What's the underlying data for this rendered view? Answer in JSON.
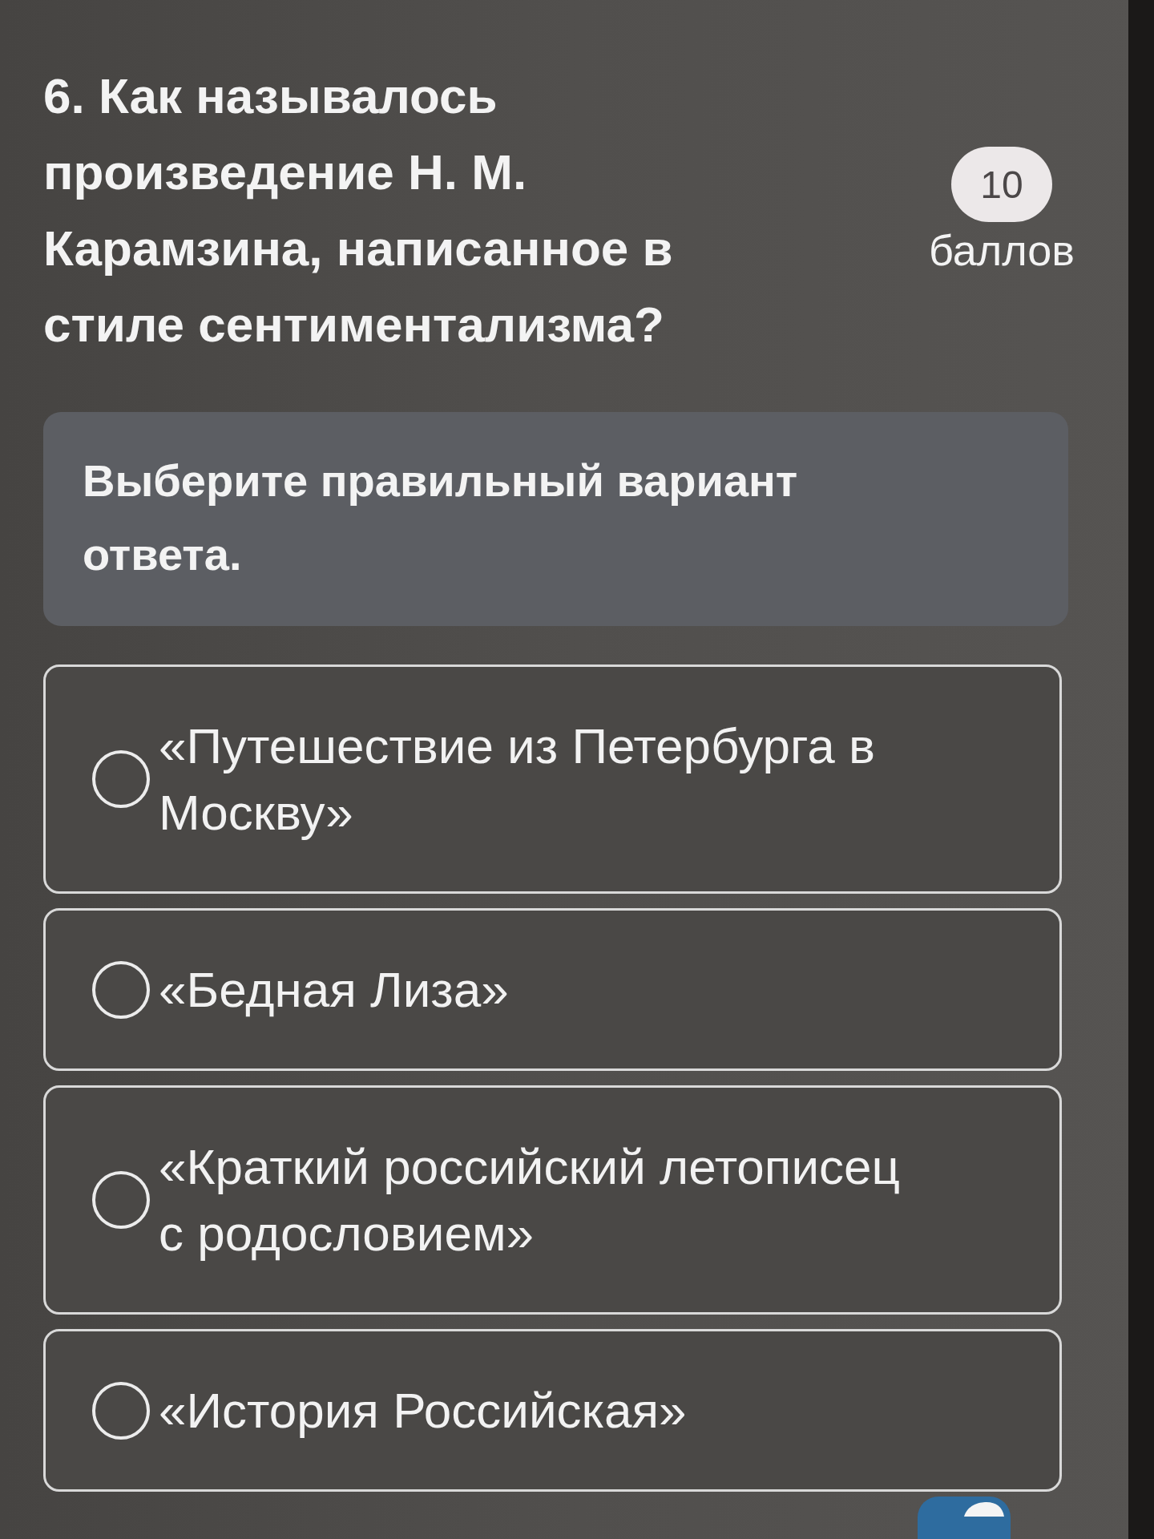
{
  "question": {
    "title": "6. Как называлось произведение Н. М. Карамзина, написанное в стиле сентиментализма?"
  },
  "points": {
    "value": "10",
    "label": "баллов"
  },
  "instruction": "Выберите правильный вариант ответа.",
  "options": [
    {
      "label": "«Путешествие из Петербурга в Москву»",
      "selected": false
    },
    {
      "label": "«Бедная Лиза»",
      "selected": false
    },
    {
      "label": "«Краткий российский летописец с родословием»",
      "selected": false
    },
    {
      "label": "«История Российская»",
      "selected": false
    }
  ]
}
